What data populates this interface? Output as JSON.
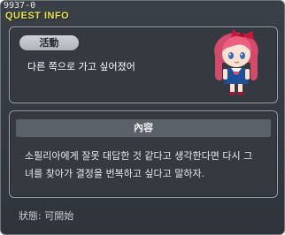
{
  "window": {
    "quest_id": "9937-0",
    "title": "QUEST INFO"
  },
  "quest": {
    "tag_label": "活動",
    "summary": "다른 쪽으로 가고 싶어졌어"
  },
  "content": {
    "header": "內容",
    "text": "소필리아에게 잘못 대답한 것 같다고 생각한다면 다시 그\n녀를 찾아가 결정을 번복하고 싶다고 말하자."
  },
  "footer": {
    "status": "狀態:  可開始"
  },
  "npc": {
    "icon": "npc-girl-red-hair-icon"
  },
  "colors": {
    "title": "#e8e34a",
    "window_bg": "#353a41",
    "panel_border": "#9aa0a8",
    "header_bar": "#5a6169",
    "hair": "#ec5f7f",
    "dress": "#1f4f99"
  }
}
